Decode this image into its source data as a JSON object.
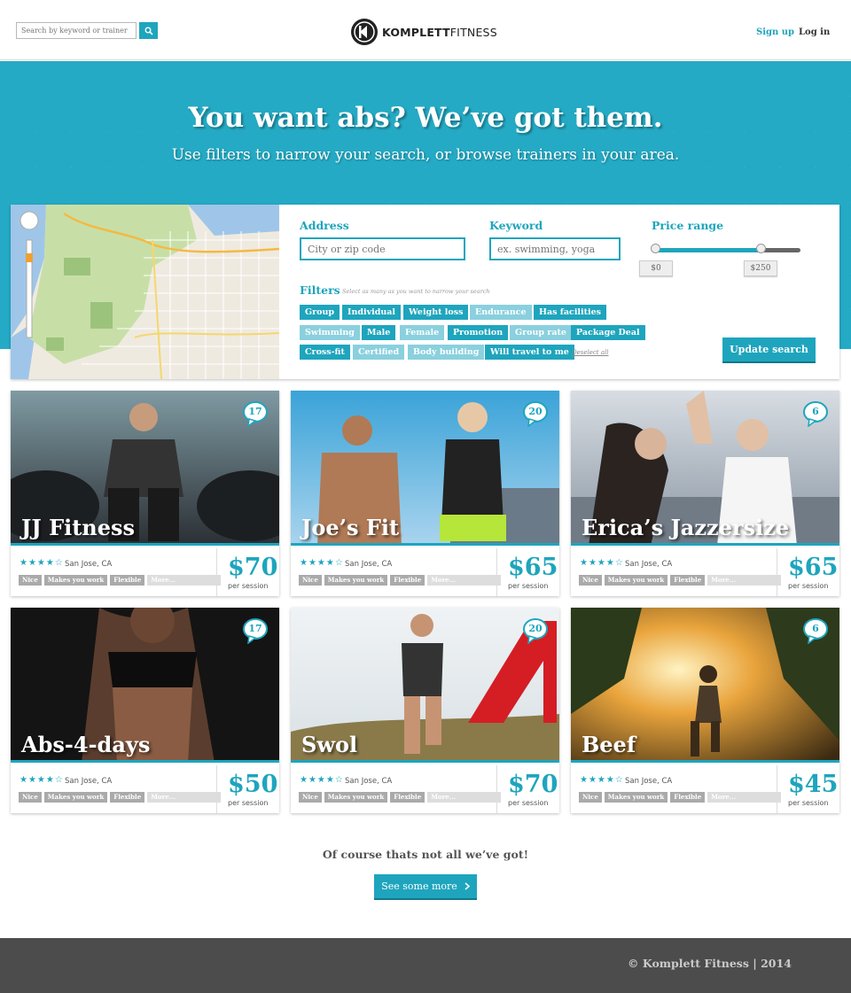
{
  "header": {
    "search_placeholder": "Search by keyword or trainer",
    "logo_bold": "KOMPLETT",
    "logo_light": "FITNESS",
    "signup": "Sign up",
    "login": "Log in"
  },
  "hero": {
    "title": "You want abs? We’ve got them.",
    "subtitle": "Use filters to narrow your search, or browse trainers in your area."
  },
  "search": {
    "address_label": "Address",
    "address_placeholder": "City or zip code",
    "keyword_label": "Keyword",
    "keyword_placeholder": "ex. swimming, yoga",
    "price_label": "Price range",
    "price_min": "$0",
    "price_max": "$250",
    "filters_label": "Filters",
    "filters_hint": "Select as many as you want to narrow your search",
    "filters": [
      {
        "label": "Group",
        "active": true
      },
      {
        "label": "Individual",
        "active": true
      },
      {
        "label": "Weight loss",
        "active": true
      },
      {
        "label": "Endurance",
        "active": false
      },
      {
        "label": "Has facilities",
        "active": true
      },
      {
        "label": "Swimming",
        "active": false
      },
      {
        "label": "Male",
        "active": true
      },
      {
        "label": "Female",
        "active": false
      },
      {
        "label": "Promotion",
        "active": true
      },
      {
        "label": "Group rate",
        "active": false
      },
      {
        "label": "Package Deal",
        "active": true
      },
      {
        "label": "Cross-fit",
        "active": true
      },
      {
        "label": "Certified",
        "active": false
      },
      {
        "label": "Body building",
        "active": false
      },
      {
        "label": "Will travel to me",
        "active": true
      }
    ],
    "deselect": "Deselect all",
    "update": "Update search"
  },
  "cards": [
    {
      "name": "JJ Fitness",
      "count": "17",
      "location": "San Jose, CA",
      "price": "$70",
      "per": "per session",
      "rating": 4,
      "tags": [
        "Nice",
        "Makes you work",
        "Flexible",
        "More..."
      ]
    },
    {
      "name": "Joe’s Fit",
      "count": "20",
      "location": "San Jose, CA",
      "price": "$65",
      "per": "per session",
      "rating": 4,
      "tags": [
        "Nice",
        "Makes you work",
        "Flexible",
        "More..."
      ]
    },
    {
      "name": "Erica’s Jazzersize",
      "count": "6",
      "location": "San Jose, CA",
      "price": "$65",
      "per": "per session",
      "rating": 4,
      "tags": [
        "Nice",
        "Makes you work",
        "Flexible",
        "More..."
      ]
    },
    {
      "name": "Abs-4-days",
      "count": "17",
      "location": "San Jose, CA",
      "price": "$50",
      "per": "per session",
      "rating": 4,
      "tags": [
        "Nice",
        "Makes you work",
        "Flexible",
        "More..."
      ]
    },
    {
      "name": "Swol",
      "count": "20",
      "location": "San Jose, CA",
      "price": "$70",
      "per": "per session",
      "rating": 4,
      "tags": [
        "Nice",
        "Makes you work",
        "Flexible",
        "More..."
      ]
    },
    {
      "name": "Beef",
      "count": "6",
      "location": "San Jose, CA",
      "price": "$45",
      "per": "per session",
      "rating": 4,
      "tags": [
        "Nice",
        "Makes you work",
        "Flexible",
        "More..."
      ]
    }
  ],
  "more": {
    "text": "Of course thats not all we’ve got!",
    "button": "See some more"
  },
  "footer": {
    "text": "© Komplett Fitness | 2014"
  },
  "colors": {
    "accent": "#1ea5bd",
    "footer": "#4c4c4c"
  }
}
